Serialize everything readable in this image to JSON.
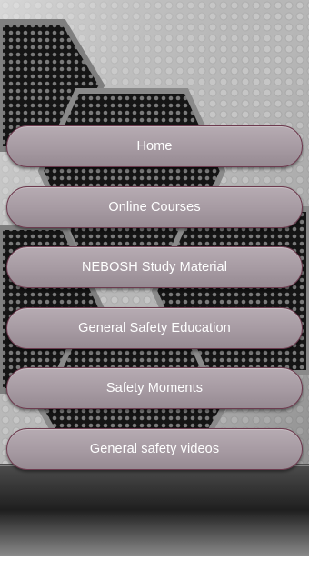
{
  "menu": {
    "items": [
      {
        "label": "Home"
      },
      {
        "label": "Online Courses"
      },
      {
        "label": "NEBOSH Study Material"
      },
      {
        "label": "General Safety Education"
      },
      {
        "label": "Safety Moments"
      },
      {
        "label": "General safety videos"
      }
    ]
  },
  "colors": {
    "button_fill": "#a69aa2",
    "button_border": "#6d3b4f",
    "button_text": "#ffffff",
    "background_light": "#c8c8c8",
    "background_dark": "#1c1c1c"
  }
}
